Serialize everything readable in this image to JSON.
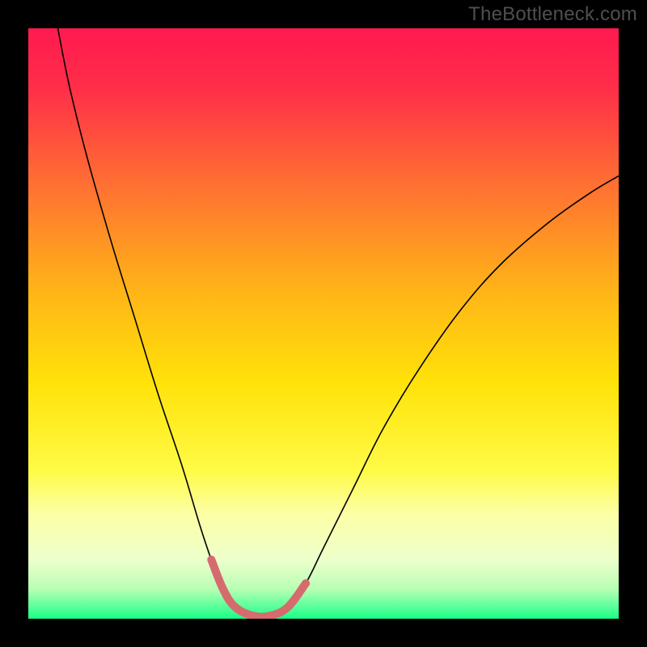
{
  "watermark": "TheBottleneck.com",
  "chart_data": {
    "type": "line",
    "title": "",
    "xlabel": "",
    "ylabel": "",
    "x_range": [
      0,
      100
    ],
    "y_range": [
      0,
      100
    ],
    "background_gradient": {
      "stops": [
        {
          "pos": 0.0,
          "color": "#ff1a50"
        },
        {
          "pos": 0.1,
          "color": "#ff2e49"
        },
        {
          "pos": 0.25,
          "color": "#ff6a34"
        },
        {
          "pos": 0.45,
          "color": "#ffb617"
        },
        {
          "pos": 0.6,
          "color": "#ffe209"
        },
        {
          "pos": 0.75,
          "color": "#fffb47"
        },
        {
          "pos": 0.82,
          "color": "#fcffa3"
        },
        {
          "pos": 0.9,
          "color": "#edffcc"
        },
        {
          "pos": 0.95,
          "color": "#b7ffb3"
        },
        {
          "pos": 1.0,
          "color": "#19ff89"
        }
      ]
    },
    "series": [
      {
        "name": "bottleneck-curve",
        "stroke": "#000000",
        "stroke_width": 1.6,
        "points": [
          {
            "x": 5.0,
            "y": 100.0
          },
          {
            "x": 7.0,
            "y": 90.0
          },
          {
            "x": 10.0,
            "y": 78.0
          },
          {
            "x": 14.0,
            "y": 64.0
          },
          {
            "x": 18.0,
            "y": 51.0
          },
          {
            "x": 22.0,
            "y": 38.0
          },
          {
            "x": 26.0,
            "y": 26.0
          },
          {
            "x": 29.0,
            "y": 16.0
          },
          {
            "x": 31.0,
            "y": 10.0
          },
          {
            "x": 33.0,
            "y": 5.0
          },
          {
            "x": 35.0,
            "y": 2.0
          },
          {
            "x": 38.0,
            "y": 0.5
          },
          {
            "x": 41.0,
            "y": 0.5
          },
          {
            "x": 44.0,
            "y": 2.0
          },
          {
            "x": 47.0,
            "y": 6.0
          },
          {
            "x": 50.0,
            "y": 12.0
          },
          {
            "x": 55.0,
            "y": 22.0
          },
          {
            "x": 60.0,
            "y": 32.0
          },
          {
            "x": 66.0,
            "y": 42.0
          },
          {
            "x": 73.0,
            "y": 52.0
          },
          {
            "x": 80.0,
            "y": 60.0
          },
          {
            "x": 88.0,
            "y": 67.0
          },
          {
            "x": 95.0,
            "y": 72.0
          },
          {
            "x": 100.0,
            "y": 75.0
          }
        ]
      },
      {
        "name": "optimal-range-marker",
        "stroke": "#d66b6e",
        "stroke_width": 10,
        "linecap": "round",
        "points": [
          {
            "x": 31.0,
            "y": 10.0
          },
          {
            "x": 33.0,
            "y": 5.0
          },
          {
            "x": 35.0,
            "y": 2.0
          },
          {
            "x": 38.0,
            "y": 0.5
          },
          {
            "x": 41.0,
            "y": 0.5
          },
          {
            "x": 44.0,
            "y": 2.0
          },
          {
            "x": 47.0,
            "y": 6.0
          }
        ]
      }
    ]
  }
}
